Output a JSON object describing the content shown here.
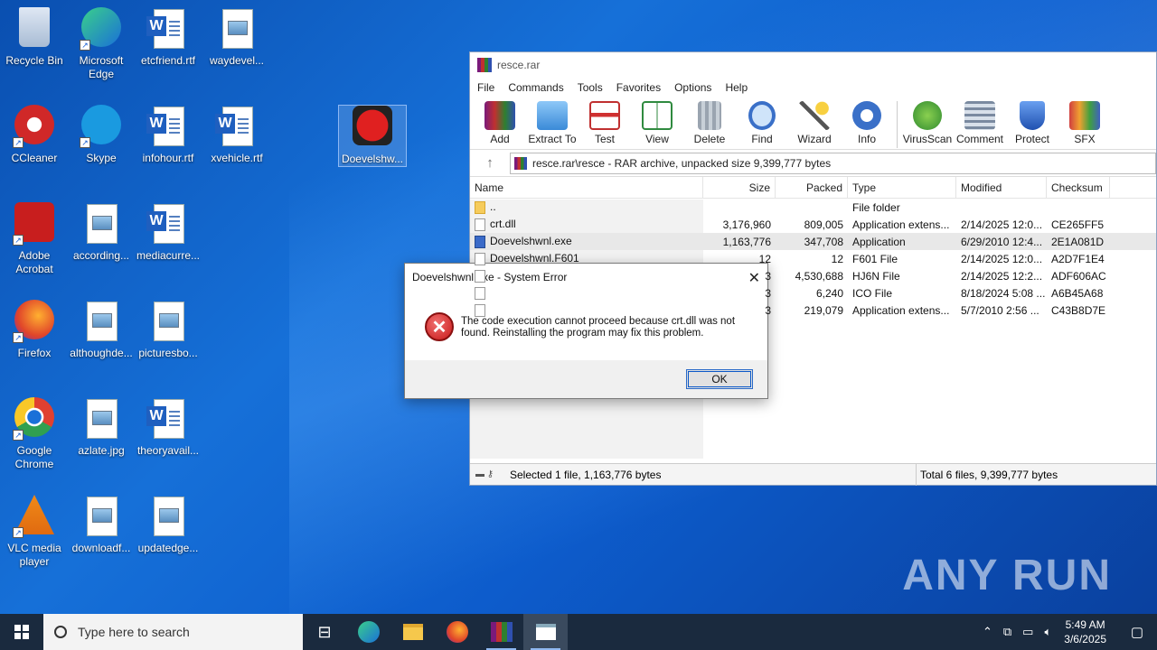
{
  "desktop": {
    "icons": [
      {
        "label": "Recycle Bin",
        "icon": "recycle-bin-icon"
      },
      {
        "label": "Microsoft Edge",
        "icon": "edge-icon"
      },
      {
        "label": "etcfriend.rtf",
        "icon": "word-doc-icon"
      },
      {
        "label": "waydevel...",
        "icon": "image-file-icon"
      },
      {
        "label": "CCleaner",
        "icon": "ccleaner-icon"
      },
      {
        "label": "Skype",
        "icon": "skype-icon"
      },
      {
        "label": "infohour.rtf",
        "icon": "word-doc-icon"
      },
      {
        "label": "xvehicle.rtf",
        "icon": "word-doc-icon"
      },
      {
        "label": "Doevelshw...",
        "icon": "media-player-icon"
      },
      {
        "label": "Adobe Acrobat",
        "icon": "acrobat-icon"
      },
      {
        "label": "according...",
        "icon": "image-file-icon"
      },
      {
        "label": "mediacurre...",
        "icon": "word-doc-icon"
      },
      {
        "label": "Firefox",
        "icon": "firefox-icon"
      },
      {
        "label": "althoughde...",
        "icon": "image-file-icon"
      },
      {
        "label": "picturesbo...",
        "icon": "image-file-icon"
      },
      {
        "label": "Google Chrome",
        "icon": "chrome-icon"
      },
      {
        "label": "azlate.jpg",
        "icon": "image-file-icon"
      },
      {
        "label": "theoryavail...",
        "icon": "word-doc-icon"
      },
      {
        "label": "VLC media player",
        "icon": "vlc-icon"
      },
      {
        "label": "downloadf...",
        "icon": "image-file-icon"
      },
      {
        "label": "updatedge...",
        "icon": "image-file-icon"
      }
    ]
  },
  "winrar": {
    "title": "resce.rar",
    "menu": [
      "File",
      "Commands",
      "Tools",
      "Favorites",
      "Options",
      "Help"
    ],
    "toolbar": [
      "Add",
      "Extract To",
      "Test",
      "View",
      "Delete",
      "Find",
      "Wizard",
      "Info",
      "VirusScan",
      "Comment",
      "Protect",
      "SFX"
    ],
    "address": "resce.rar\\resce - RAR archive, unpacked size 9,399,777 bytes",
    "columns": [
      "Name",
      "Size",
      "Packed",
      "Type",
      "Modified",
      "Checksum"
    ],
    "rows": [
      {
        "name": "..",
        "size": "",
        "packed": "",
        "type": "File folder",
        "modified": "",
        "checksum": ""
      },
      {
        "name": "crt.dll",
        "size": "3,176,960",
        "packed": "809,005",
        "type": "Application extens...",
        "modified": "2/14/2025 12:0...",
        "checksum": "CE265FF5"
      },
      {
        "name": "Doevelshwnl.exe",
        "size": "1,163,776",
        "packed": "347,708",
        "type": "Application",
        "modified": "6/29/2010 12:4...",
        "checksum": "2E1A081D"
      },
      {
        "name": "Doevelshwnl.F601",
        "size": "12",
        "packed": "12",
        "type": "F601 File",
        "modified": "2/14/2025 12:0...",
        "checksum": "A2D7F1E4"
      },
      {
        "name": "",
        "size": "3",
        "packed": "4,530,688",
        "type": "HJ6N File",
        "modified": "2/14/2025 12:2...",
        "checksum": "ADF606AC"
      },
      {
        "name": "",
        "size": "3",
        "packed": "6,240",
        "type": "ICO File",
        "modified": "8/18/2024 5:08 ...",
        "checksum": "A6B45A68"
      },
      {
        "name": "",
        "size": "3",
        "packed": "219,079",
        "type": "Application extens...",
        "modified": "5/7/2010 2:56 ...",
        "checksum": "C43B8D7E"
      }
    ],
    "status_left": "Selected 1 file, 1,163,776 bytes",
    "status_right": "Total 6 files, 9,399,777 bytes"
  },
  "dialog": {
    "title": "Doevelshwnl.exe - System Error",
    "message": "The code execution cannot proceed because crt.dll was not found. Reinstalling the program may fix this problem.",
    "ok_label": "OK"
  },
  "taskbar": {
    "search_placeholder": "Type here to search",
    "time": "5:49 AM",
    "date": "3/6/2025"
  },
  "watermark": "ANY RUN"
}
